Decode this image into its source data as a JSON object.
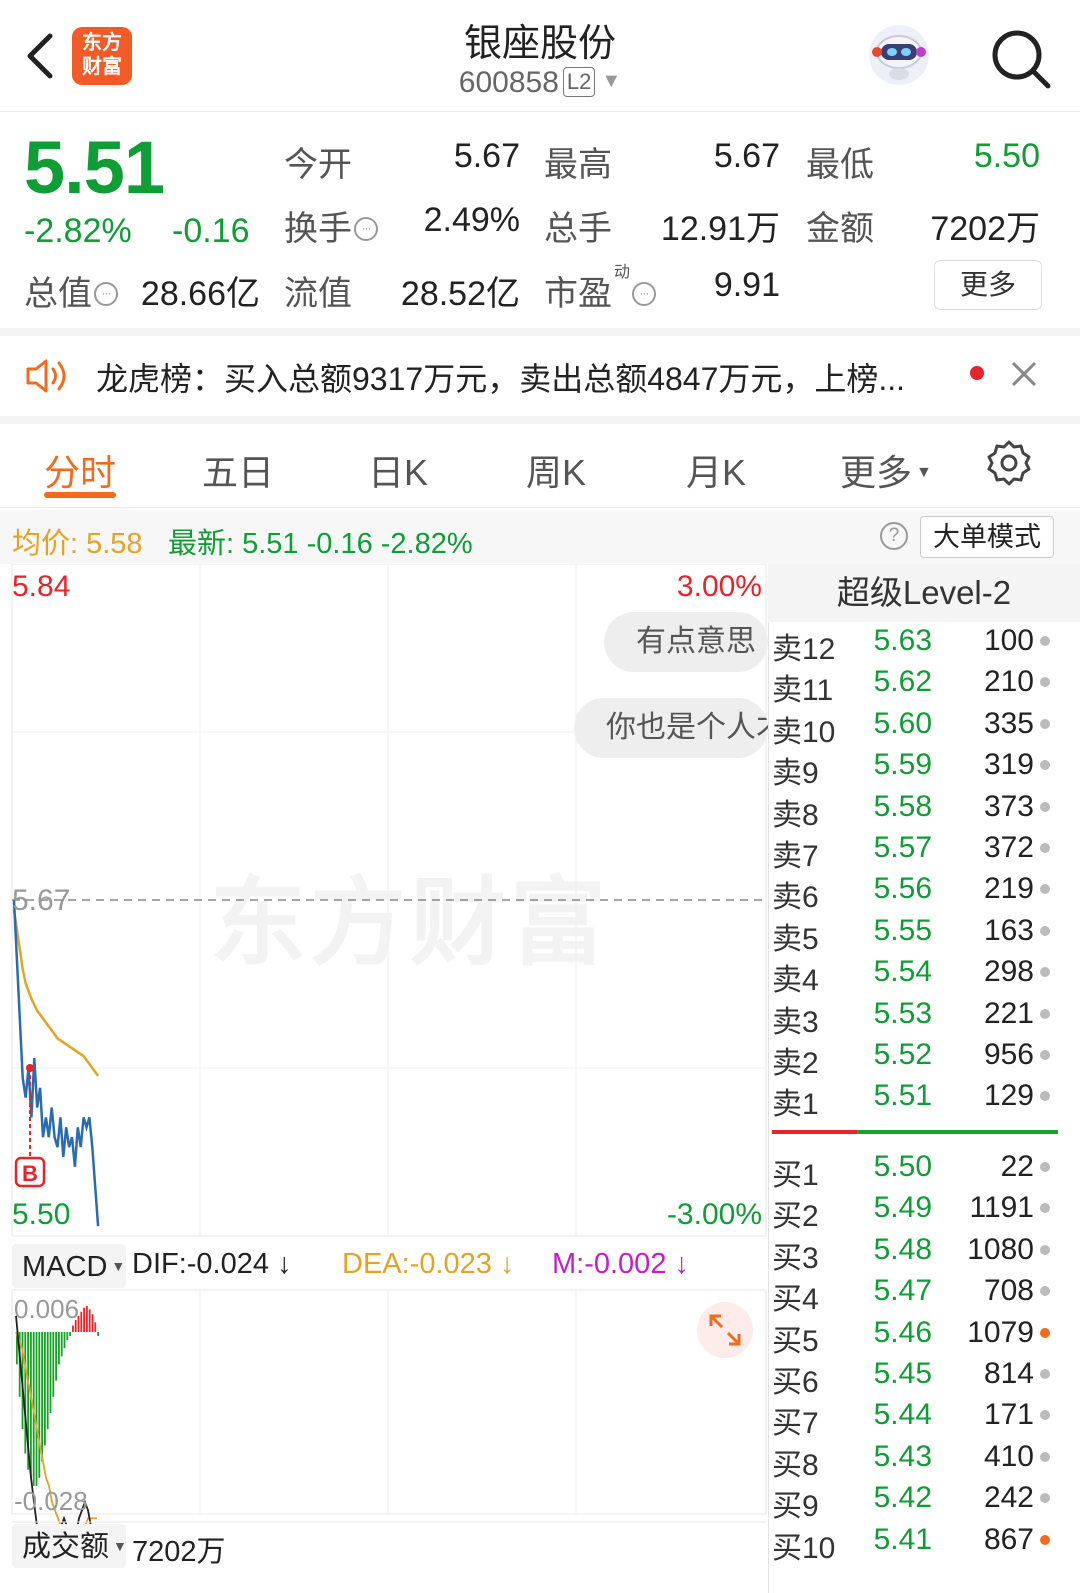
{
  "header": {
    "logo_line1": "东方",
    "logo_line2": "财富",
    "title": "银座股份",
    "code": "600858",
    "level_badge": "L2"
  },
  "quote": {
    "price": "5.51",
    "change_pct": "-2.82%",
    "change_abs": "-0.16",
    "open_label": "今开",
    "open": "5.67",
    "high_label": "最高",
    "high": "5.67",
    "low_label": "最低",
    "low": "5.50",
    "turnover_label": "换手",
    "turnover": "2.49%",
    "volume_label": "总手",
    "volume": "12.91万",
    "amount_label": "金额",
    "amount": "7202万",
    "mktcap_label": "总值",
    "mktcap": "28.66亿",
    "float_label": "流值",
    "float_cap": "28.52亿",
    "pe_label": "市盈",
    "pe_sup": "动",
    "pe": "9.91",
    "more_label": "更多"
  },
  "notice": {
    "text": "龙虎榜：买入总额9317万元，卖出总额4847万元，上榜..."
  },
  "tabs": [
    "分时",
    "五日",
    "日K",
    "周K",
    "月K",
    "更多"
  ],
  "avg_bar": {
    "avg_label": "均价: 5.58",
    "latest_label": "最新: 5.51  -0.16  -2.82%",
    "help": "?",
    "big_order_mode": "大单模式"
  },
  "chart_data": {
    "type": "line",
    "title": "",
    "y_max_label": "5.84",
    "y_min_label": "5.50",
    "y_prev_close_label": "5.67",
    "pct_top_label": "3.00%",
    "pct_bottom_label": "-3.00%",
    "ylim": [
      5.5,
      5.84
    ],
    "prev_close": 5.67,
    "series": [
      {
        "name": "价格",
        "color": "#2b6cb0",
        "values": [
          5.67,
          5.64,
          5.61,
          5.58,
          5.57,
          5.585,
          5.56,
          5.59,
          5.565,
          5.575,
          5.55,
          5.56,
          5.55,
          5.565,
          5.55,
          5.545,
          5.56,
          5.54,
          5.555,
          5.545,
          5.55,
          5.535,
          5.555,
          5.545,
          5.56,
          5.555,
          5.56,
          5.545,
          5.525,
          5.505
        ]
      },
      {
        "name": "均价",
        "color": "#e3a425",
        "values": [
          5.665,
          5.655,
          5.645,
          5.635,
          5.628,
          5.624,
          5.62,
          5.617,
          5.614,
          5.612,
          5.61,
          5.608,
          5.606,
          5.604,
          5.602,
          5.6,
          5.599,
          5.598,
          5.597,
          5.596,
          5.595,
          5.594,
          5.593,
          5.592,
          5.591,
          5.589,
          5.587,
          5.585,
          5.583,
          5.581
        ]
      }
    ],
    "marker_label": "B",
    "watermark": "东方财富",
    "bubbles": [
      "有点意思",
      "你也是个人才"
    ]
  },
  "macd": {
    "selector": "MACD",
    "dif": "DIF:-0.024",
    "dea": "DEA:-0.023",
    "m": "M:-0.002",
    "arrow": "↓",
    "top_label": "0.006",
    "bottom_label": "-0.028",
    "colors": {
      "dif": "#222222",
      "dea": "#e3a425",
      "m": "#c21fcb",
      "up": "#e8232a",
      "down": "#19a127"
    }
  },
  "volume": {
    "selector": "成交额",
    "value": "7202万"
  },
  "orderbook": {
    "title": "超级Level-2",
    "asks": [
      {
        "name": "卖12",
        "price": "5.63",
        "qty": "100"
      },
      {
        "name": "卖11",
        "price": "5.62",
        "qty": "210"
      },
      {
        "name": "卖10",
        "price": "5.60",
        "qty": "335"
      },
      {
        "name": "卖9",
        "price": "5.59",
        "qty": "319"
      },
      {
        "name": "卖8",
        "price": "5.58",
        "qty": "373"
      },
      {
        "name": "卖7",
        "price": "5.57",
        "qty": "372"
      },
      {
        "name": "卖6",
        "price": "5.56",
        "qty": "219"
      },
      {
        "name": "卖5",
        "price": "5.55",
        "qty": "163"
      },
      {
        "name": "卖4",
        "price": "5.54",
        "qty": "298"
      },
      {
        "name": "卖3",
        "price": "5.53",
        "qty": "221"
      },
      {
        "name": "卖2",
        "price": "5.52",
        "qty": "956"
      },
      {
        "name": "卖1",
        "price": "5.51",
        "qty": "129"
      }
    ],
    "bids": [
      {
        "name": "买1",
        "price": "5.50",
        "qty": "22"
      },
      {
        "name": "买2",
        "price": "5.49",
        "qty": "1191"
      },
      {
        "name": "买3",
        "price": "5.48",
        "qty": "1080"
      },
      {
        "name": "买4",
        "price": "5.47",
        "qty": "708"
      },
      {
        "name": "买5",
        "price": "5.46",
        "qty": "1079",
        "highlight": true
      },
      {
        "name": "买6",
        "price": "5.45",
        "qty": "814"
      },
      {
        "name": "买7",
        "price": "5.44",
        "qty": "171"
      },
      {
        "name": "买8",
        "price": "5.43",
        "qty": "410"
      },
      {
        "name": "买9",
        "price": "5.42",
        "qty": "242"
      },
      {
        "name": "买10",
        "price": "5.41",
        "qty": "867",
        "highlight": true
      }
    ],
    "buy_ratio": 0.3
  }
}
